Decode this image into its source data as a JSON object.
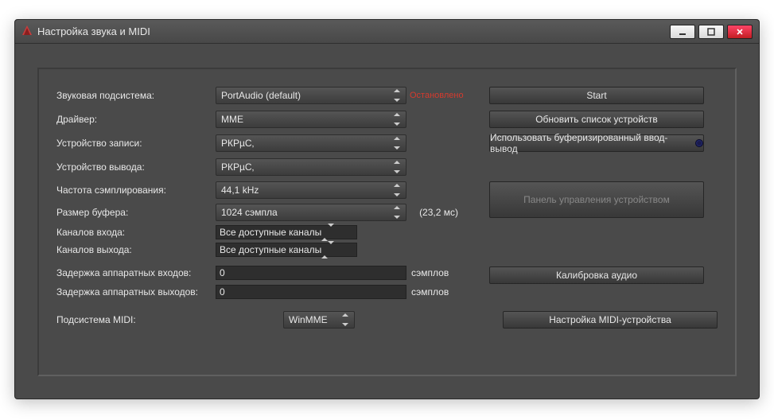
{
  "window": {
    "title": "Настройка звука и MIDI"
  },
  "status": "Остановлено",
  "labels": {
    "subsystem": "Звуковая подсистема:",
    "driver": "Драйвер:",
    "rec_device": "Устройство записи:",
    "out_device": "Устройство вывода:",
    "sample_rate": "Частота сэмплирования:",
    "buffer_size": "Размер буфера:",
    "in_channels": "Каналов входа:",
    "out_channels": "Каналов выхода:",
    "in_latency": "Задержка аппаратных входов:",
    "out_latency": "Задержка аппаратных выходов:",
    "midi_subsystem": "Подсистема MIDI:",
    "samples_unit": "сэмплов"
  },
  "values": {
    "subsystem": "PortAudio (default)",
    "driver": "MME",
    "rec_device": "РКРµС‚",
    "out_device": "РКРµС‚",
    "sample_rate": "44,1 kHz",
    "buffer_size": "1024 сэмпла",
    "buffer_hint": "(23,2 мс)",
    "in_channels": "Все доступные каналы",
    "out_channels": "Все доступные каналы",
    "in_latency": "0",
    "out_latency": "0",
    "midi_subsystem": "WinMME"
  },
  "buttons": {
    "start": "Start",
    "refresh": "Обновить список устройств",
    "buffered_io": "Использовать буферизированный ввод-вывод",
    "device_panel": "Панель управления устройством",
    "calibrate": "Калибровка аудио",
    "midi_setup": "Настройка MIDI-устройства"
  }
}
